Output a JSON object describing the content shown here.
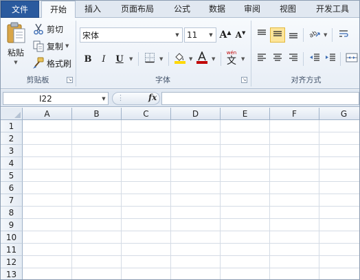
{
  "ribbon": {
    "tabs": [
      {
        "id": "file",
        "label": "文件"
      },
      {
        "id": "home",
        "label": "开始"
      },
      {
        "id": "insert",
        "label": "插入"
      },
      {
        "id": "page_layout",
        "label": "页面布局"
      },
      {
        "id": "formulas",
        "label": "公式"
      },
      {
        "id": "data",
        "label": "数据"
      },
      {
        "id": "review",
        "label": "审阅"
      },
      {
        "id": "view",
        "label": "视图"
      },
      {
        "id": "developer",
        "label": "开发工具"
      }
    ],
    "active_tab": "开始",
    "clipboard": {
      "paste_label": "粘贴",
      "cut_label": "剪切",
      "copy_label": "复制",
      "format_painter_label": "格式刷",
      "group_label": "剪贴板"
    },
    "font": {
      "font_name": "宋体",
      "font_size": "11",
      "bold_label": "B",
      "italic_label": "I",
      "underline_label": "U",
      "grow_label": "A",
      "shrink_label": "A",
      "phonetic_label": "wén",
      "phonetic_char": "文",
      "group_label": "字体",
      "fill_color": "#ffd800",
      "font_color": "#c00000"
    },
    "alignment": {
      "group_label": "对齐方式",
      "pressed_button": "middle-align"
    }
  },
  "formula_bar": {
    "name_box": "I22",
    "fx_label": "fx",
    "formula": ""
  },
  "sheet": {
    "columns": [
      "A",
      "B",
      "C",
      "D",
      "E",
      "F",
      "G"
    ],
    "rows": [
      "1",
      "2",
      "3",
      "4",
      "5",
      "6",
      "7",
      "8",
      "9",
      "10",
      "11",
      "12",
      "13"
    ]
  },
  "colors": {
    "file_tab": "#2a5a9e",
    "ribbon_bg": "#eef3f9",
    "header_bg": "#e4ebf3",
    "gridline": "#d4dbe5",
    "pressed": "#fde59a"
  }
}
